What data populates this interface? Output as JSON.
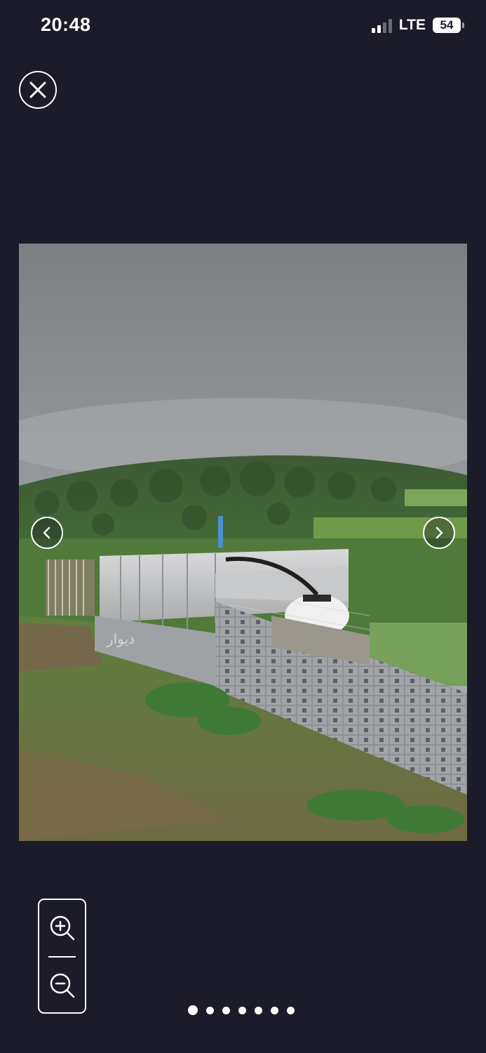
{
  "status_bar": {
    "time": "20:48",
    "network": "LTE",
    "battery_level": "54",
    "signal_icon": "cellular-signal-icon",
    "battery_icon": "battery-icon"
  },
  "viewer": {
    "close_icon": "close-icon",
    "prev_icon": "chevron-left-icon",
    "next_icon": "chevron-right-icon",
    "zoom_in_icon": "zoom-in-icon",
    "zoom_out_icon": "zoom-out-icon",
    "photo_watermark": "دیوار"
  },
  "pagination": {
    "total": 7,
    "current": 1
  },
  "colors": {
    "background": "#1b1b29",
    "foreground": "#ffffff"
  }
}
